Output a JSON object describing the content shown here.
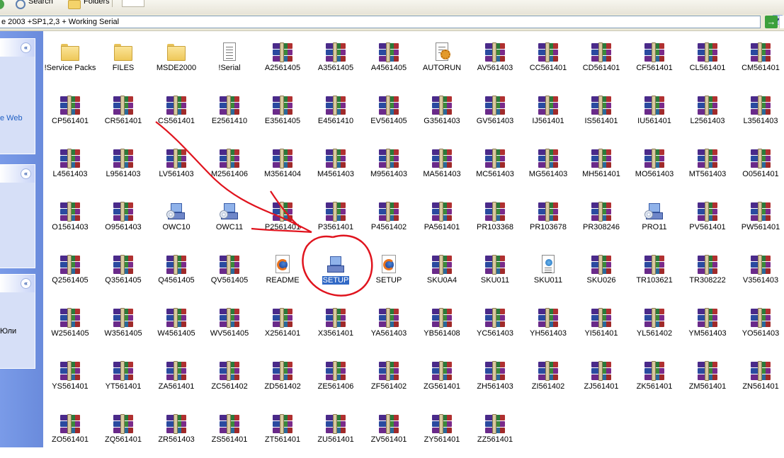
{
  "toolbar": {
    "search_label": "Search",
    "folders_label": "Folders"
  },
  "address": {
    "value": "e 2003 +SP1,2,3 + Working Serial"
  },
  "go_arrow": "→",
  "taskpane": {
    "panel1_text": "e Web",
    "panel3_text": "Юли",
    "collapse_glyph": "«"
  },
  "items": [
    {
      "label": "!Service Packs",
      "type": "folder"
    },
    {
      "label": "FILES",
      "type": "folder"
    },
    {
      "label": "MSDE2000",
      "type": "folder"
    },
    {
      "label": "!Serial",
      "type": "doc"
    },
    {
      "label": "A2561405",
      "type": "rar"
    },
    {
      "label": "A3561405",
      "type": "rar"
    },
    {
      "label": "A4561405",
      "type": "rar"
    },
    {
      "label": "AUTORUN",
      "type": "autorun"
    },
    {
      "label": "AV561403",
      "type": "rar"
    },
    {
      "label": "CC561401",
      "type": "rar"
    },
    {
      "label": "CD561401",
      "type": "rar"
    },
    {
      "label": "CF561401",
      "type": "rar"
    },
    {
      "label": "CL561401",
      "type": "rar"
    },
    {
      "label": "CM561401",
      "type": "rar"
    },
    {
      "label": "CP561401",
      "type": "rar"
    },
    {
      "label": "CR561401",
      "type": "rar"
    },
    {
      "label": "CS561401",
      "type": "rar"
    },
    {
      "label": "E2561410",
      "type": "rar"
    },
    {
      "label": "E3561405",
      "type": "rar"
    },
    {
      "label": "E4561410",
      "type": "rar"
    },
    {
      "label": "EV561405",
      "type": "rar"
    },
    {
      "label": "G3561403",
      "type": "rar"
    },
    {
      "label": "GV561403",
      "type": "rar"
    },
    {
      "label": "IJ561401",
      "type": "rar"
    },
    {
      "label": "IS561401",
      "type": "rar"
    },
    {
      "label": "IU561401",
      "type": "rar"
    },
    {
      "label": "L2561403",
      "type": "rar"
    },
    {
      "label": "L3561403",
      "type": "rar"
    },
    {
      "label": "L4561403",
      "type": "rar"
    },
    {
      "label": "L9561403",
      "type": "rar"
    },
    {
      "label": "LV561403",
      "type": "rar"
    },
    {
      "label": "M2561406",
      "type": "rar"
    },
    {
      "label": "M3561404",
      "type": "rar"
    },
    {
      "label": "M4561403",
      "type": "rar"
    },
    {
      "label": "M9561403",
      "type": "rar"
    },
    {
      "label": "MA561403",
      "type": "rar"
    },
    {
      "label": "MC561403",
      "type": "rar"
    },
    {
      "label": "MG561403",
      "type": "rar"
    },
    {
      "label": "MH561401",
      "type": "rar"
    },
    {
      "label": "MO561403",
      "type": "rar"
    },
    {
      "label": "MT561403",
      "type": "rar"
    },
    {
      "label": "O0561401",
      "type": "rar"
    },
    {
      "label": "O1561403",
      "type": "rar"
    },
    {
      "label": "O9561403",
      "type": "rar"
    },
    {
      "label": "OWC10",
      "type": "setup"
    },
    {
      "label": "OWC11",
      "type": "setup"
    },
    {
      "label": "P2561401",
      "type": "rar"
    },
    {
      "label": "P3561401",
      "type": "rar"
    },
    {
      "label": "P4561402",
      "type": "rar"
    },
    {
      "label": "PA561401",
      "type": "rar"
    },
    {
      "label": "PR103368",
      "type": "rar"
    },
    {
      "label": "PR103678",
      "type": "rar"
    },
    {
      "label": "PR308246",
      "type": "rar"
    },
    {
      "label": "PRO11",
      "type": "setup"
    },
    {
      "label": "PV561401",
      "type": "rar"
    },
    {
      "label": "PW561401",
      "type": "rar"
    },
    {
      "label": "Q2561405",
      "type": "rar"
    },
    {
      "label": "Q3561405",
      "type": "rar"
    },
    {
      "label": "Q4561405",
      "type": "rar"
    },
    {
      "label": "QV561405",
      "type": "rar"
    },
    {
      "label": "README",
      "type": "ffdoc"
    },
    {
      "label": "SETUP",
      "type": "setupexe",
      "selected": true
    },
    {
      "label": "SETUP",
      "type": "ffdoc"
    },
    {
      "label": "SKU0A4",
      "type": "rar"
    },
    {
      "label": "SKU011",
      "type": "rar"
    },
    {
      "label": "SKU011",
      "type": "webdoc"
    },
    {
      "label": "SKU026",
      "type": "rar"
    },
    {
      "label": "TR103621",
      "type": "rar"
    },
    {
      "label": "TR308222",
      "type": "rar"
    },
    {
      "label": "V3561403",
      "type": "rar"
    },
    {
      "label": "W2561405",
      "type": "rar"
    },
    {
      "label": "W3561405",
      "type": "rar"
    },
    {
      "label": "W4561405",
      "type": "rar"
    },
    {
      "label": "WV561405",
      "type": "rar"
    },
    {
      "label": "X2561401",
      "type": "rar"
    },
    {
      "label": "X3561401",
      "type": "rar"
    },
    {
      "label": "YA561403",
      "type": "rar"
    },
    {
      "label": "YB561408",
      "type": "rar"
    },
    {
      "label": "YC561403",
      "type": "rar"
    },
    {
      "label": "YH561403",
      "type": "rar"
    },
    {
      "label": "YI561401",
      "type": "rar"
    },
    {
      "label": "YL561402",
      "type": "rar"
    },
    {
      "label": "YM561403",
      "type": "rar"
    },
    {
      "label": "YO561403",
      "type": "rar"
    },
    {
      "label": "YS561401",
      "type": "rar"
    },
    {
      "label": "YT561401",
      "type": "rar"
    },
    {
      "label": "ZA561401",
      "type": "rar"
    },
    {
      "label": "ZC561402",
      "type": "rar"
    },
    {
      "label": "ZD561402",
      "type": "rar"
    },
    {
      "label": "ZE561406",
      "type": "rar"
    },
    {
      "label": "ZF561402",
      "type": "rar"
    },
    {
      "label": "ZG561401",
      "type": "rar"
    },
    {
      "label": "ZH561403",
      "type": "rar"
    },
    {
      "label": "ZI561402",
      "type": "rar"
    },
    {
      "label": "ZJ561401",
      "type": "rar"
    },
    {
      "label": "ZK561401",
      "type": "rar"
    },
    {
      "label": "ZM561401",
      "type": "rar"
    },
    {
      "label": "ZN561401",
      "type": "rar"
    },
    {
      "label": "ZO561401",
      "type": "rar"
    },
    {
      "label": "ZQ561401",
      "type": "rar"
    },
    {
      "label": "ZR561403",
      "type": "rar"
    },
    {
      "label": "ZS561401",
      "type": "rar"
    },
    {
      "label": "ZT561401",
      "type": "rar"
    },
    {
      "label": "ZU561401",
      "type": "rar"
    },
    {
      "label": "ZV561401",
      "type": "rar"
    },
    {
      "label": "ZY561401",
      "type": "rar"
    },
    {
      "label": "ZZ561401",
      "type": "rar"
    }
  ],
  "annotation_color": "#e0141e"
}
